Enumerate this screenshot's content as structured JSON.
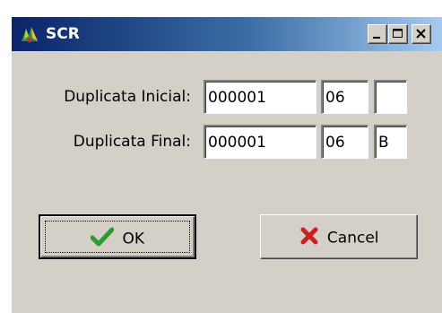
{
  "window": {
    "title": "SCR"
  },
  "form": {
    "initial_label": "Duplicata Inicial:",
    "final_label": "Duplicata Final:",
    "initial_number": "000001",
    "initial_month": "06",
    "initial_series": "",
    "final_number": "000001",
    "final_month": "06",
    "final_series": "B"
  },
  "buttons": {
    "ok_label": "OK",
    "cancel_label": "Cancel"
  },
  "icons": {
    "app": "app-icon",
    "minimize": "minimize-icon",
    "maximize": "maximize-icon",
    "close": "close-icon",
    "ok": "checkmark-icon",
    "cancel": "x-icon"
  },
  "colors": {
    "titlebar_start": "#0a246a",
    "titlebar_end": "#a6caf0",
    "face": "#d4d0c8",
    "ok_check": "#2e9b2e",
    "cancel_x": "#cc1f1f"
  }
}
